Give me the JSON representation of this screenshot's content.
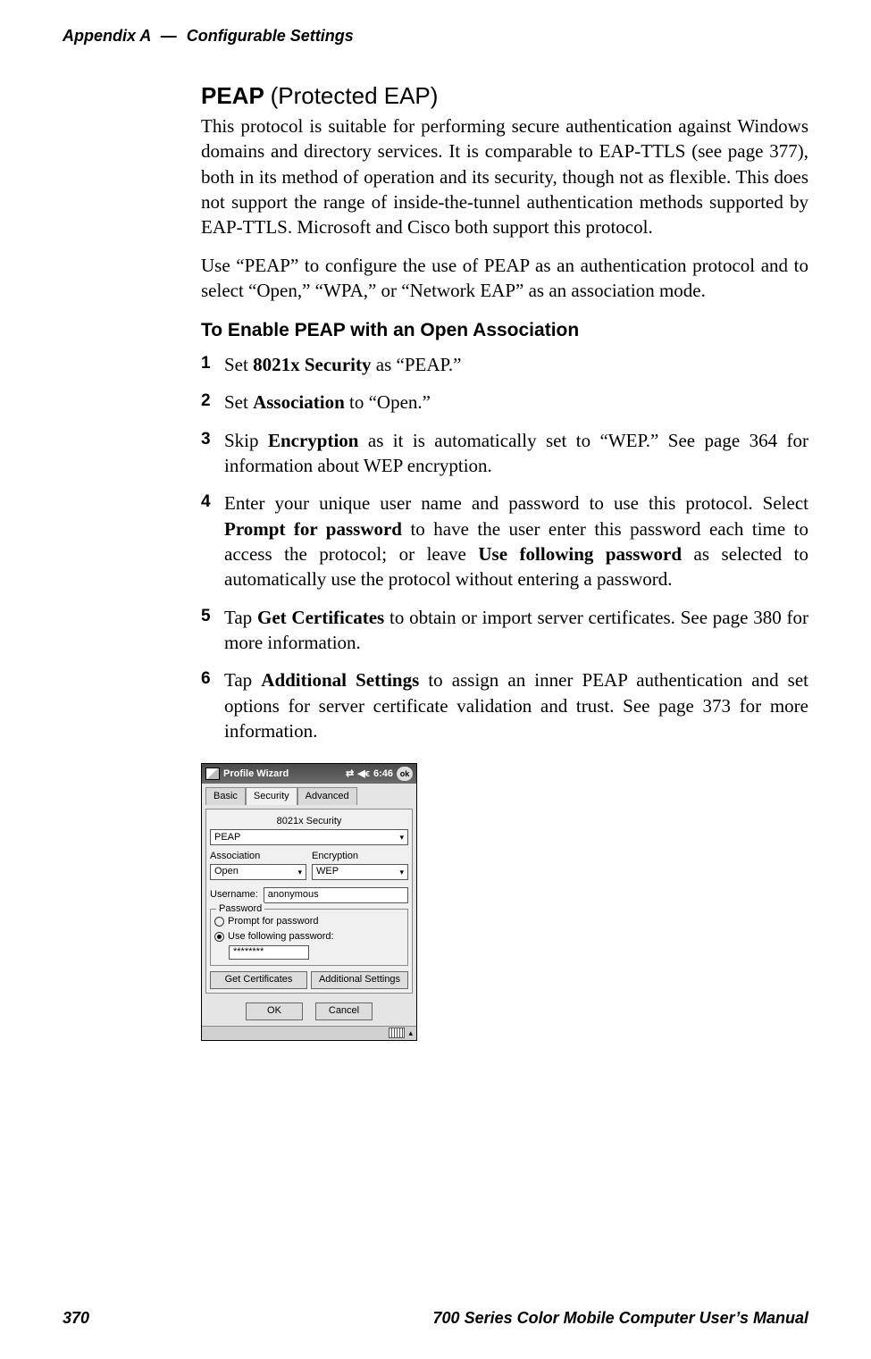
{
  "running_head": {
    "appendix": "Appendix  A",
    "separator": "—",
    "section": "Configurable Settings"
  },
  "section": {
    "title_bold": "PEAP",
    "title_paren": "(Protected EAP)",
    "p1": "This protocol is suitable for performing secure authentication against Windows domains and directory services. It is comparable to EAP-TTLS (see page 377), both in its method of operation and its security, though not as flexible. This does not support the range of inside-the-tunnel authentication methods supported by EAP-TTLS. Microsoft and Cisco both support this protocol.",
    "p2": "Use “PEAP” to configure the use of PEAP as an authentication protocol and to select “Open,” “WPA,” or “Network EAP” as an association mode.",
    "sub": "To Enable PEAP with an Open Association",
    "steps": {
      "s1_a": "Set ",
      "s1_b": "8021x Security",
      "s1_c": " as “PEAP.”",
      "s2_a": "Set ",
      "s2_b": "Association",
      "s2_c": " to “Open.”",
      "s3_a": "Skip ",
      "s3_b": "Encryption",
      "s3_c": " as it is automatically set to “WEP.” See page 364 for information about WEP encryption.",
      "s4_a": "Enter your unique user name and password to use this protocol. Select ",
      "s4_b": "Prompt for password",
      "s4_c": " to have the user enter this password each time to access the protocol; or leave ",
      "s4_d": "Use following password",
      "s4_e": " as selected to automatically use the protocol without entering a password.",
      "s5_a": "Tap ",
      "s5_b": "Get Certificates",
      "s5_c": " to obtain or import server certificates. See page 380 for more information.",
      "s6_a": "Tap ",
      "s6_b": "Additional Settings",
      "s6_c": " to assign an inner PEAP authentication and set options for server certificate validation and trust. See page 373 for more information."
    },
    "nums": {
      "n1": "1",
      "n2": "2",
      "n3": "3",
      "n4": "4",
      "n5": "5",
      "n6": "6"
    }
  },
  "ppc": {
    "title": "Profile Wizard",
    "time": "6:46",
    "ok": "ok",
    "tabs": {
      "basic": "Basic",
      "security": "Security",
      "advanced": "Advanced"
    },
    "labels": {
      "x8021": "8021x Security",
      "assoc": "Association",
      "enc": "Encryption",
      "username": "Username:",
      "password_legend": "Password",
      "radio_prompt": "Prompt for password",
      "radio_usefollow": "Use following password:",
      "get_certs": "Get Certificates",
      "add_settings": "Additional Settings",
      "ok_btn": "OK",
      "cancel_btn": "Cancel"
    },
    "values": {
      "x8021": "PEAP",
      "assoc": "Open",
      "enc": "WEP",
      "username": "anonymous",
      "password": "********"
    },
    "conn_icon": "⇄",
    "vol_icon": "◀ϵ",
    "caret": "▾",
    "up_caret": "▴"
  },
  "footer": {
    "page": "370",
    "title": "700 Series Color Mobile Computer User’s Manual"
  }
}
